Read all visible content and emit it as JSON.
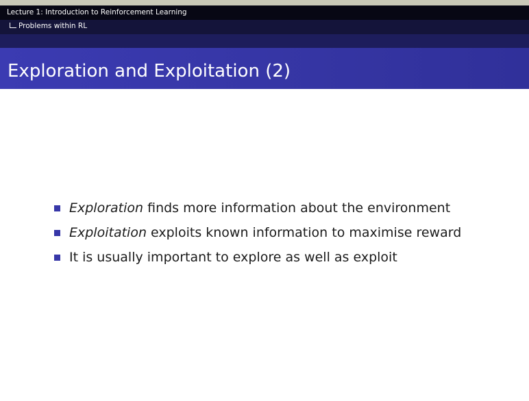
{
  "header": {
    "lecture_title": "Lecture 1: Introduction to Reinforcement Learning",
    "section": "Problems within RL"
  },
  "slide": {
    "title": "Exploration and Exploitation (2)",
    "bullets": [
      {
        "emphasis": "Exploration",
        "text": " finds more information about the environment"
      },
      {
        "emphasis": "Exploitation",
        "text": " exploits known information to maximise reward"
      },
      {
        "emphasis": "",
        "text": "It is usually important to explore as well as exploit"
      }
    ]
  },
  "colors": {
    "header_bg": "#070714",
    "title_bar_bg": "#3b3bb2",
    "bullet_marker": "#3737a8"
  }
}
